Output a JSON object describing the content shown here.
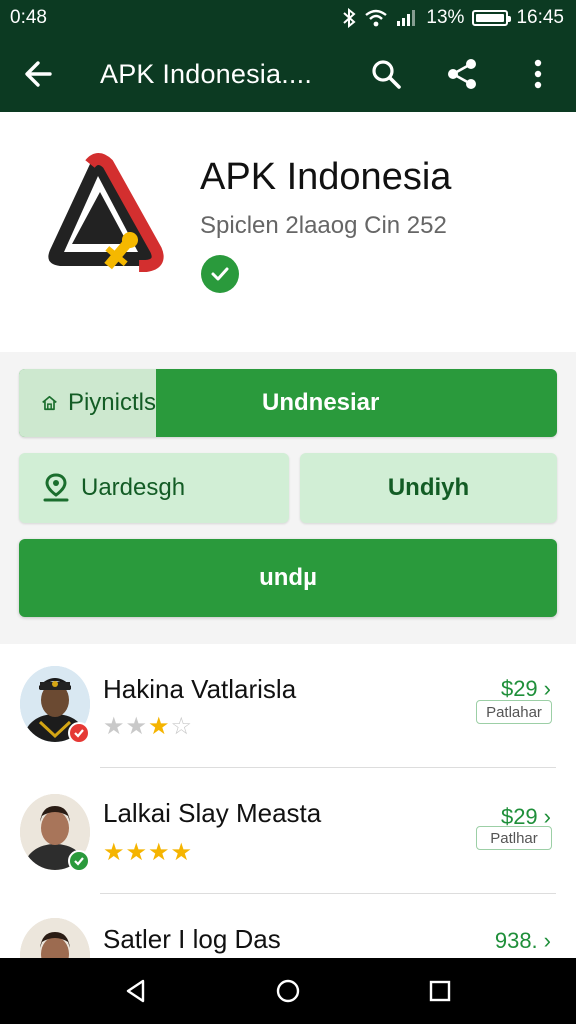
{
  "status_bar": {
    "time_left": "0:48",
    "battery_percent": "13%",
    "time_right": "16:45",
    "icons": [
      "bluetooth-icon",
      "wifi-icon",
      "signal-icon",
      "battery-icon"
    ]
  },
  "app_bar": {
    "title": "APK Indonesia....",
    "icons": [
      "back-arrow-icon",
      "search-icon",
      "share-icon",
      "more-vert-icon"
    ]
  },
  "app": {
    "name": "APK Indonesia",
    "subtitle": "Spiclen 2laaog Cin 252",
    "verified_icon": "check-icon"
  },
  "buttons": {
    "split_left_label": "Piynictls",
    "split_right_label": "Undnesiar",
    "download_left_label": "Uardesgh",
    "download_right_label": "Undiyh",
    "main_label": "undµ"
  },
  "list": [
    {
      "name": "Hakina Vatlarisla",
      "rating": 3,
      "rating_max": 5,
      "price": "$29",
      "price_label": "Patlahar",
      "badge_color": "#e53935"
    },
    {
      "name": "Lalkai Slay Measta",
      "rating": 4,
      "rating_max": 4,
      "price": "$29",
      "price_label": "Patlhar",
      "badge_color": "#2a9a3c"
    },
    {
      "name": "Satler I log Das",
      "price": "938."
    }
  ],
  "nav_bar": {
    "icons": [
      "back-triangle-icon",
      "home-circle-icon",
      "recents-square-icon"
    ]
  },
  "colors": {
    "dark_green": "#0c3a22",
    "accent_green": "#2a9a3c",
    "light_green": "#d1eed5"
  }
}
